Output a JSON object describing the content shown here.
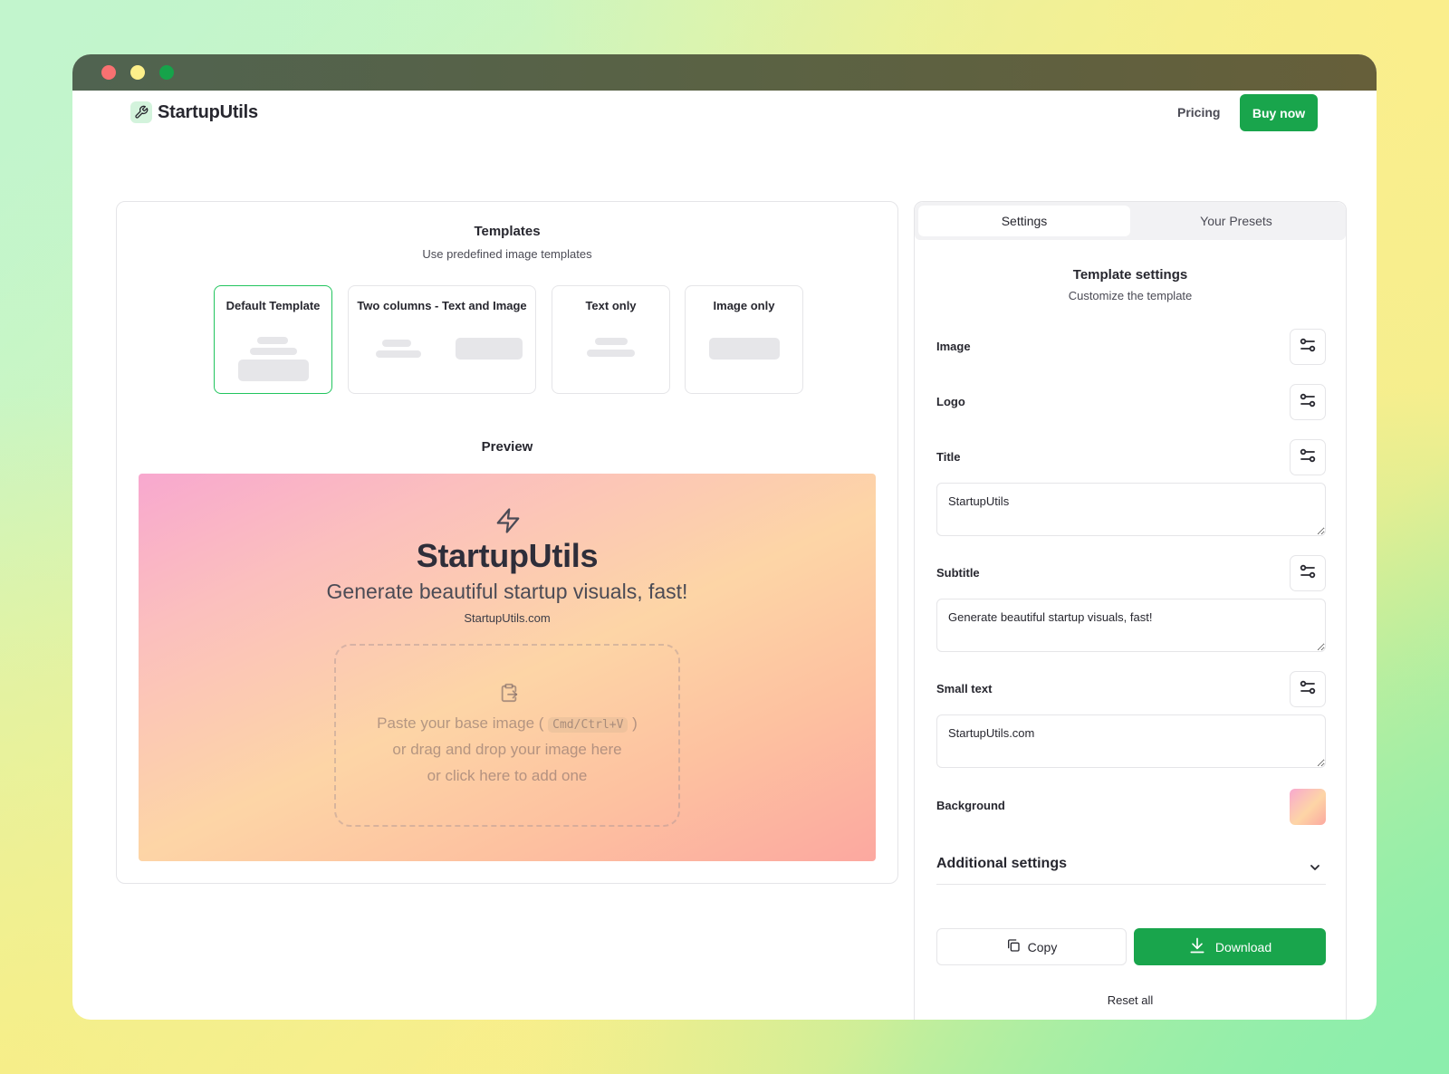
{
  "window": {
    "traffic_lights": [
      "close",
      "minimize",
      "maximize"
    ]
  },
  "nav": {
    "logo_icon": "wrench-icon",
    "brand": "StartupUtils",
    "pricing_label": "Pricing",
    "buy_label": "Buy now"
  },
  "templates": {
    "title": "Templates",
    "subtitle": "Use predefined image templates",
    "items": [
      {
        "label": "Default Template",
        "selected": true
      },
      {
        "label": "Two columns - Text and Image",
        "selected": false
      },
      {
        "label": "Text only",
        "selected": false
      },
      {
        "label": "Image only",
        "selected": false
      }
    ]
  },
  "preview": {
    "heading": "Preview",
    "icon": "bolt-icon",
    "title": "StartupUtils",
    "subtitle": "Generate beautiful startup visuals, fast!",
    "small_text": "StartupUtils.com",
    "dropzone": {
      "icon": "clipboard-paste-icon",
      "line1_prefix": "Paste your base image (",
      "shortcut": "Cmd/Ctrl+V",
      "line1_suffix": ")",
      "line2": "or drag and drop your image here",
      "line3": "or click here to add one"
    }
  },
  "settings_panel": {
    "tabs": [
      {
        "label": "Settings",
        "active": true
      },
      {
        "label": "Your Presets",
        "active": false
      }
    ],
    "title": "Template settings",
    "subtitle": "Customize the template",
    "fields": {
      "image": {
        "label": "Image",
        "icon": "sliders-icon"
      },
      "logo": {
        "label": "Logo",
        "icon": "sliders-icon"
      },
      "title": {
        "label": "Title",
        "icon": "sliders-icon",
        "value": "StartupUtils"
      },
      "subtitle": {
        "label": "Subtitle",
        "icon": "sliders-icon",
        "value": "Generate beautiful startup visuals, fast!"
      },
      "small_text": {
        "label": "Small text",
        "icon": "sliders-icon",
        "value": "StartupUtils.com"
      },
      "background": {
        "label": "Background",
        "colors": [
          "#f8a8cf",
          "#fdd5a6",
          "#fca8a0"
        ]
      }
    },
    "additional_settings_label": "Additional settings",
    "copy_label": "Copy",
    "download_label": "Download",
    "reset_label": "Reset all"
  },
  "colors": {
    "accent": "#19a54c",
    "selected_border": "#22c55e"
  }
}
